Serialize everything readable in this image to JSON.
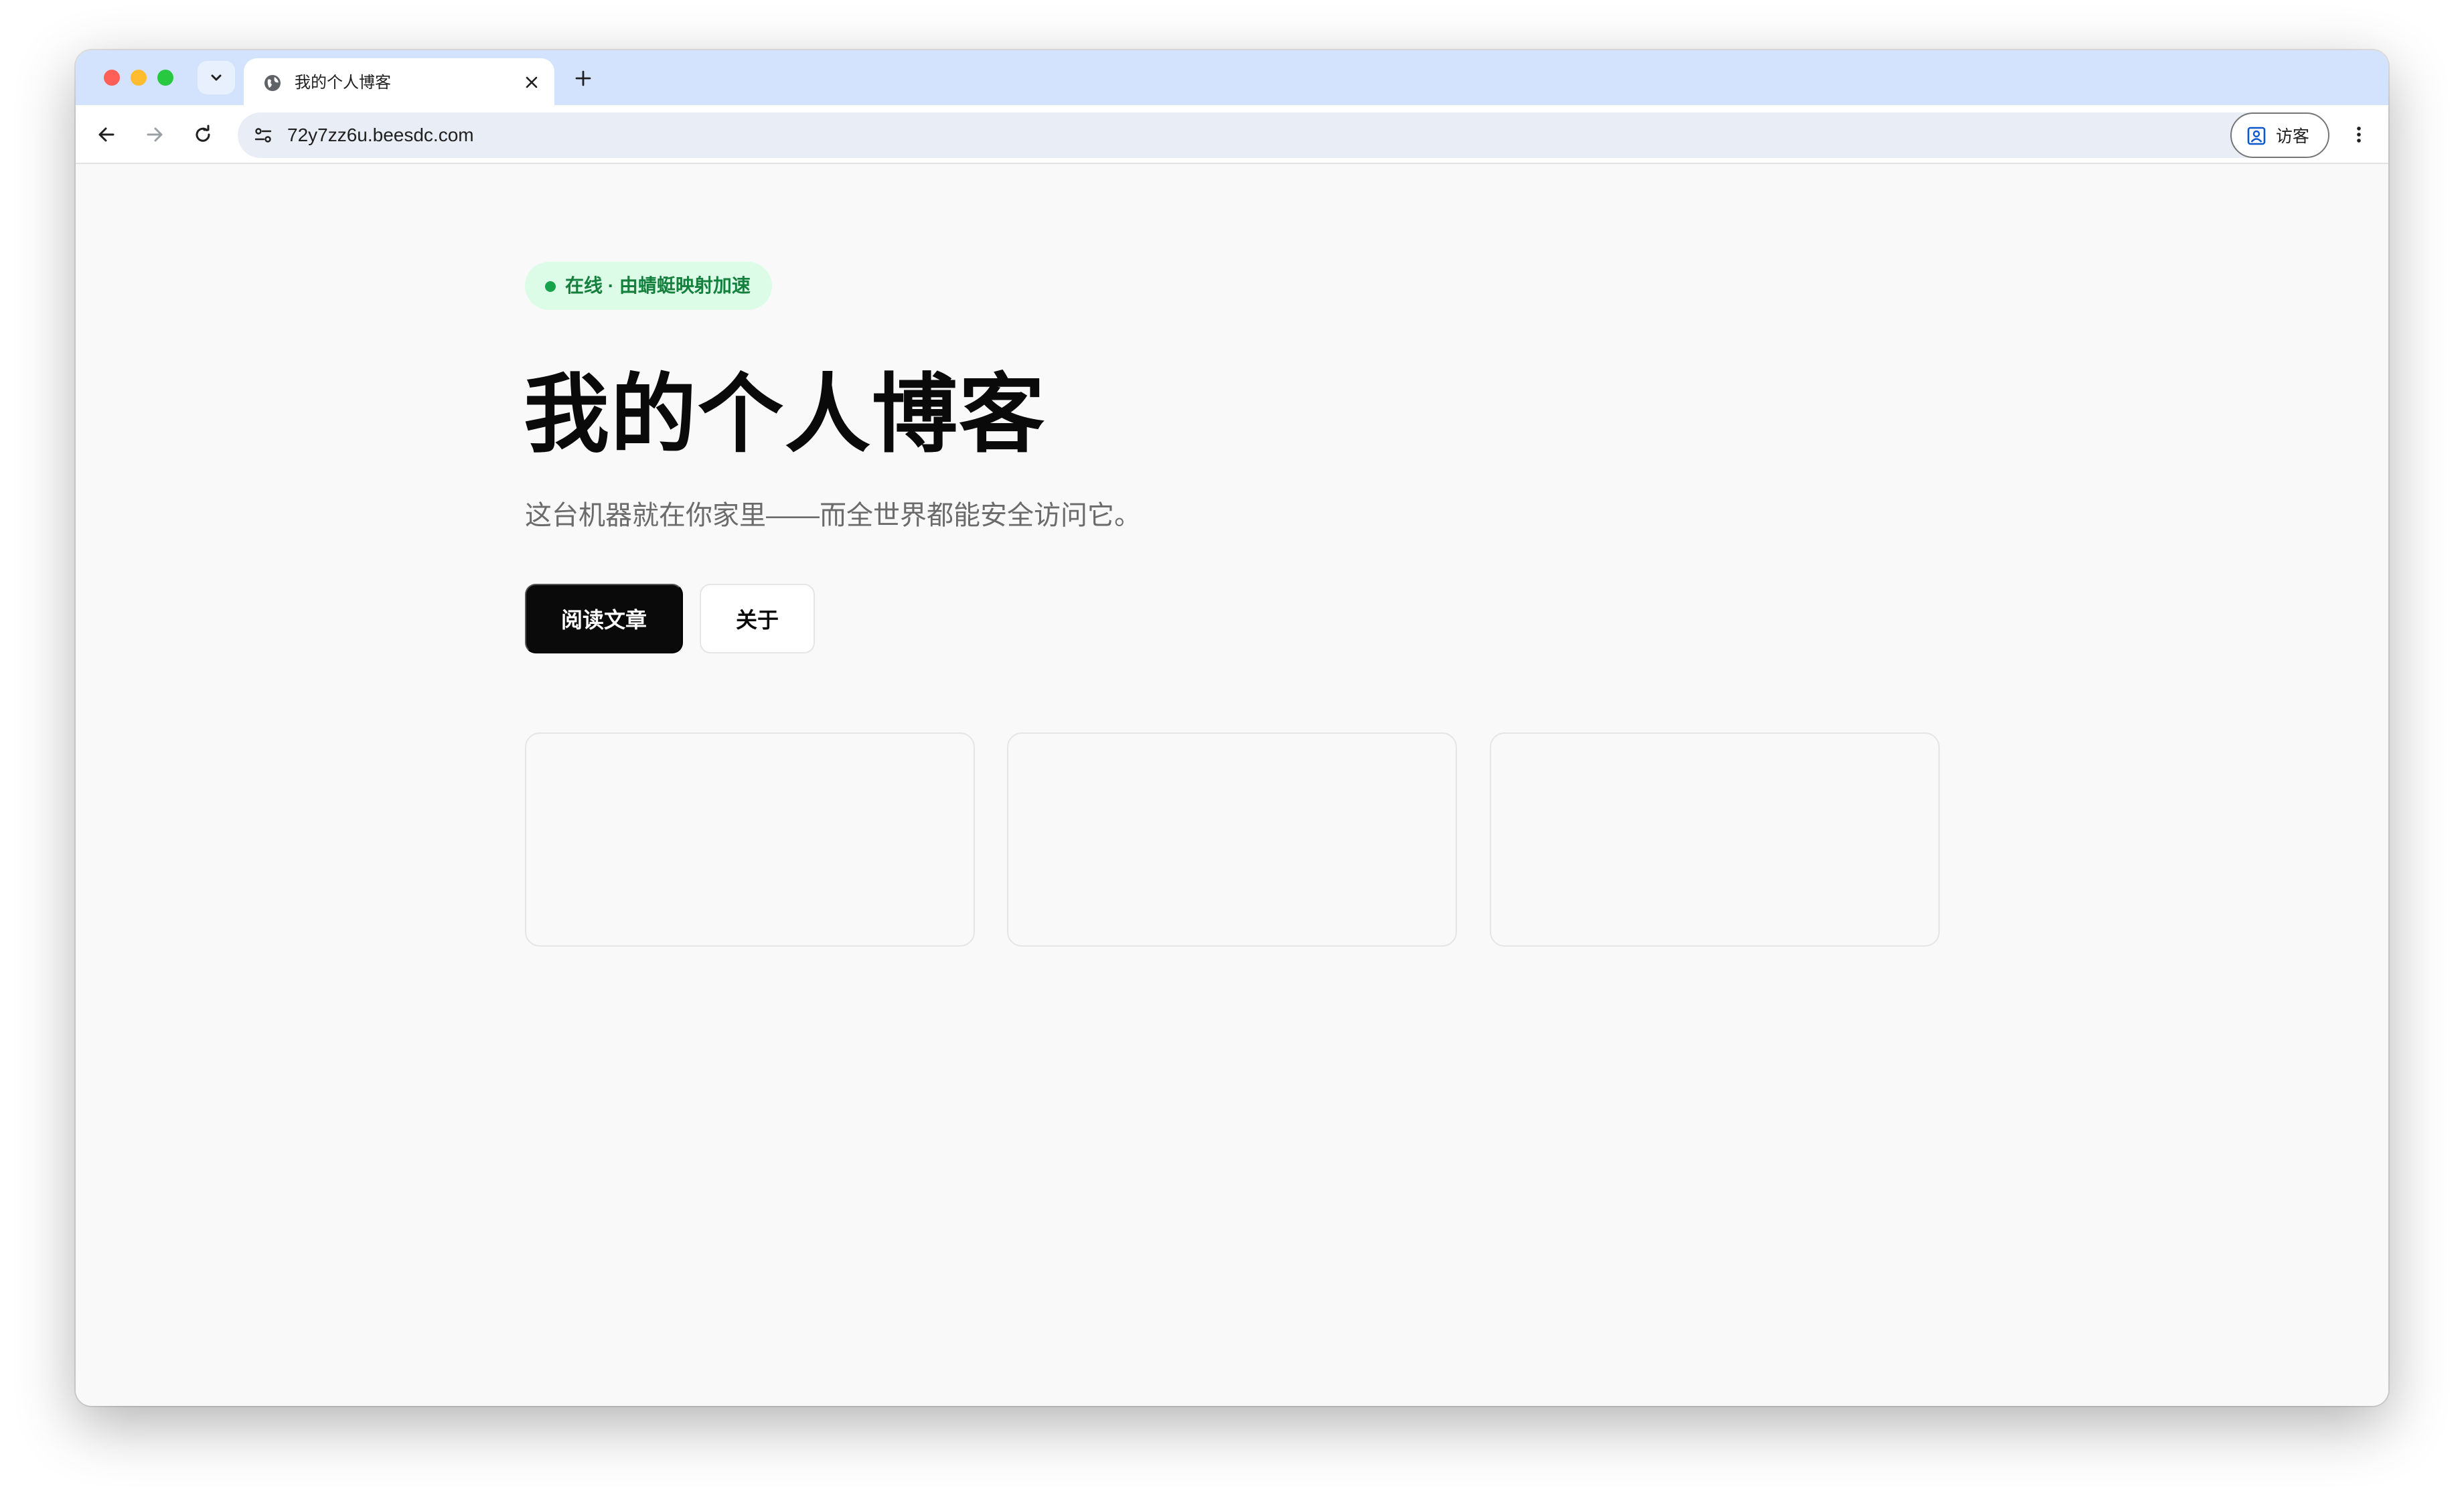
{
  "browser": {
    "tab": {
      "title": "我的个人博客"
    },
    "address_bar": {
      "url": "72y7zz6u.beesdc.com"
    },
    "profile": {
      "label": "访客"
    }
  },
  "page": {
    "badge": "在线 · 由蜻蜓映射加速",
    "title": "我的个人博客",
    "subtitle": "这台机器就在你家里——而全世界都能安全访问它。",
    "buttons": {
      "primary": "阅读文章",
      "secondary": "关于"
    }
  },
  "colors": {
    "tab_strip": "#d3e3fd",
    "badge_bg": "#dcfce7",
    "badge_text": "#15803d",
    "primary_button": "#0a0a0a"
  }
}
